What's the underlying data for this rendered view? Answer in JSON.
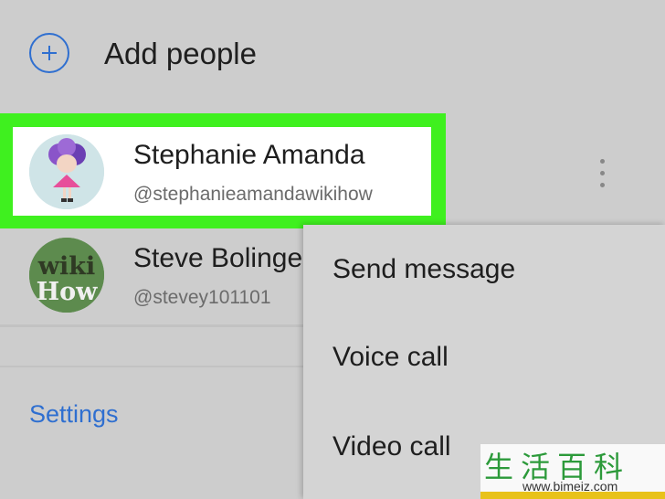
{
  "add_people": {
    "label": "Add people"
  },
  "contacts": [
    {
      "name": "Stephanie Amanda",
      "handle": "@stephanieamandawikihow"
    },
    {
      "name": "Steve Bolinge",
      "handle": "@stevey101101",
      "avatar_text_top": "wiki",
      "avatar_text_bottom": "How"
    }
  ],
  "settings_label": "Settings",
  "menu": {
    "items": [
      {
        "label": "Send message"
      },
      {
        "label": "Voice call"
      },
      {
        "label": "Video call"
      }
    ]
  },
  "watermark": {
    "glyphs": "生活百科",
    "url": "www.bimeiz.com"
  },
  "colors": {
    "accent": "#2f6fd0",
    "highlight": "#3ff01f",
    "background": "#cdcdcd"
  }
}
